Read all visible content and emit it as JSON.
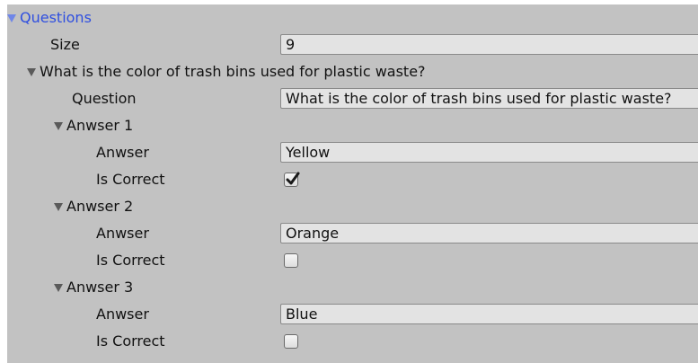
{
  "questions": {
    "foldout_label": "Questions",
    "size_label": "Size",
    "size_value": "9",
    "item0": {
      "foldout_label": "What is the color of trash bins used for plastic waste?",
      "question_label": "Question",
      "question_value": "What is the color of trash bins used for plastic waste?",
      "answers": [
        {
          "foldout_label": "Anwser 1",
          "anwser_label": "Anwser",
          "anwser_value": "Yellow",
          "is_correct_label": "Is Correct",
          "is_correct": true
        },
        {
          "foldout_label": "Anwser 2",
          "anwser_label": "Anwser",
          "anwser_value": "Orange",
          "is_correct_label": "Is Correct",
          "is_correct": false
        },
        {
          "foldout_label": "Anwser 3",
          "anwser_label": "Anwser",
          "anwser_value": "Blue",
          "is_correct_label": "Is Correct",
          "is_correct": false
        }
      ]
    }
  },
  "colors": {
    "panel_bg": "#c2c2c2",
    "focused_text": "#2f4fe0",
    "field_bg": "#e3e3e3"
  }
}
